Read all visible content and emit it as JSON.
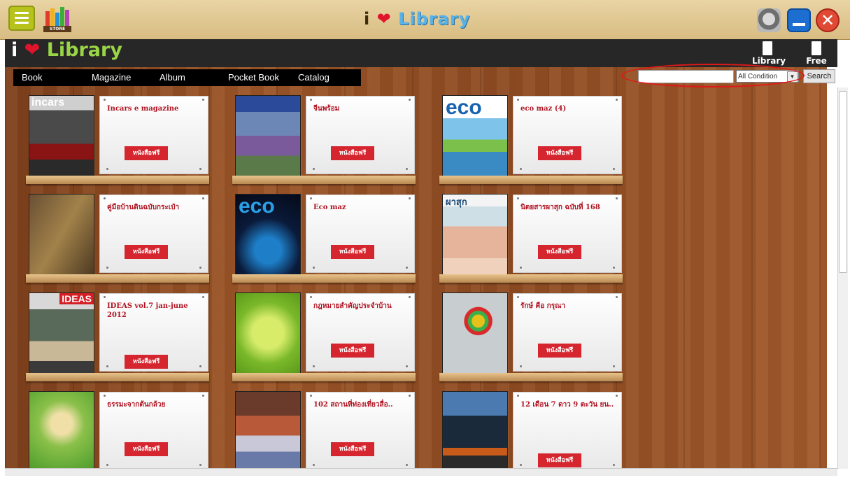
{
  "app": {
    "title_i": "i",
    "title_heart": "❤",
    "title_library": "Library"
  },
  "topbar": {
    "store_label": "STORE"
  },
  "header": {
    "brand_i": "i",
    "brand_heart": "❤",
    "brand_library": "Library",
    "library_link": "Library",
    "free_link": "Free"
  },
  "nav": {
    "items": [
      "Book",
      "Magazine",
      "Album",
      "Pocket Book",
      "Catalog"
    ]
  },
  "search": {
    "value": "",
    "condition": "All Condition",
    "button": "Search"
  },
  "colors": {
    "accent_red": "#d5252e",
    "title_red": "#b01422",
    "wood": "#8c4a22"
  },
  "items": [
    {
      "title": "Incars e magazine",
      "cover_text": "incars",
      "button": "หนังสือฟรี"
    },
    {
      "title": "จีนพร้อม",
      "cover_text": "",
      "button": "หนังสือฟรี"
    },
    {
      "title": "eco maz (4)",
      "cover_text": "eco",
      "button": "หนังสือฟรี"
    },
    {
      "title": "คู่มือบ้านดินฉบับกระเป๋า",
      "cover_text": "",
      "button": "หนังสือฟรี"
    },
    {
      "title": "Eco maz",
      "cover_text": "eco",
      "button": "หนังสือฟรี"
    },
    {
      "title": "นิตยสารผาสุก ฉบับที่ 168",
      "cover_text": "ผาสุก",
      "button": "หนังสือฟรี"
    },
    {
      "title": "IDEAS vol.7 jan-june 2012",
      "cover_text": "IDEAS",
      "button": "หนังสือฟรี"
    },
    {
      "title": "กฎหมายสำคัญประจำบ้าน",
      "cover_text": "",
      "button": "หนังสือฟรี"
    },
    {
      "title": "รักษ์ คือ กรุณา",
      "cover_text": "",
      "button": "หนังสือฟรี"
    },
    {
      "title": "ธรรมะจากต้นกล้วย",
      "cover_text": "",
      "button": "หนังสือฟรี"
    },
    {
      "title": "102 สถานที่ท่องเที่ยวสื่อ..",
      "cover_text": "",
      "button": "หนังสือฟรี"
    },
    {
      "title": "12 เดือน 7 ดาว 9 ตะวัน ยน..",
      "cover_text": "",
      "button": "หนังสือฟรี"
    }
  ]
}
